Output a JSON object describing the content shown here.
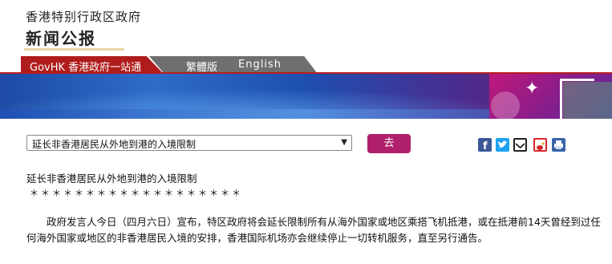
{
  "header": {
    "gov_name": "香港特别行政区政府",
    "section_title": "新闻公报"
  },
  "nav": {
    "govhk_label": "GovHK 香港政府一站通",
    "traditional_label": "繁體版",
    "english_label": "English"
  },
  "press_selector": {
    "selected": "延长非香港居民从外地到港的入境限制",
    "go_label": "去"
  },
  "share": {
    "icons": [
      "facebook-icon",
      "twitter-icon",
      "mail-icon",
      "weibo-icon",
      "print-icon"
    ]
  },
  "article": {
    "title": "延长非香港居民从外地到港的入境限制",
    "separator": "＊＊＊＊＊＊＊＊＊＊＊＊＊＊＊＊＊＊＊",
    "paragraph": "　　政府发言人今日（四月六日）宣布，特区政府将会延长限制所有从海外国家或地区乘搭飞机抵港，或在抵港前14天曾经到过任何海外国家或地区的非香港居民入境的安排，香港国际机场亦会继续停止一切转机服务，直至另行通告。"
  },
  "colors": {
    "nav_red": "#b01c1c",
    "nav_gray": "#6f6f6f",
    "button_magenta": "#b0206a",
    "header_underline": "#e8d9a8"
  }
}
